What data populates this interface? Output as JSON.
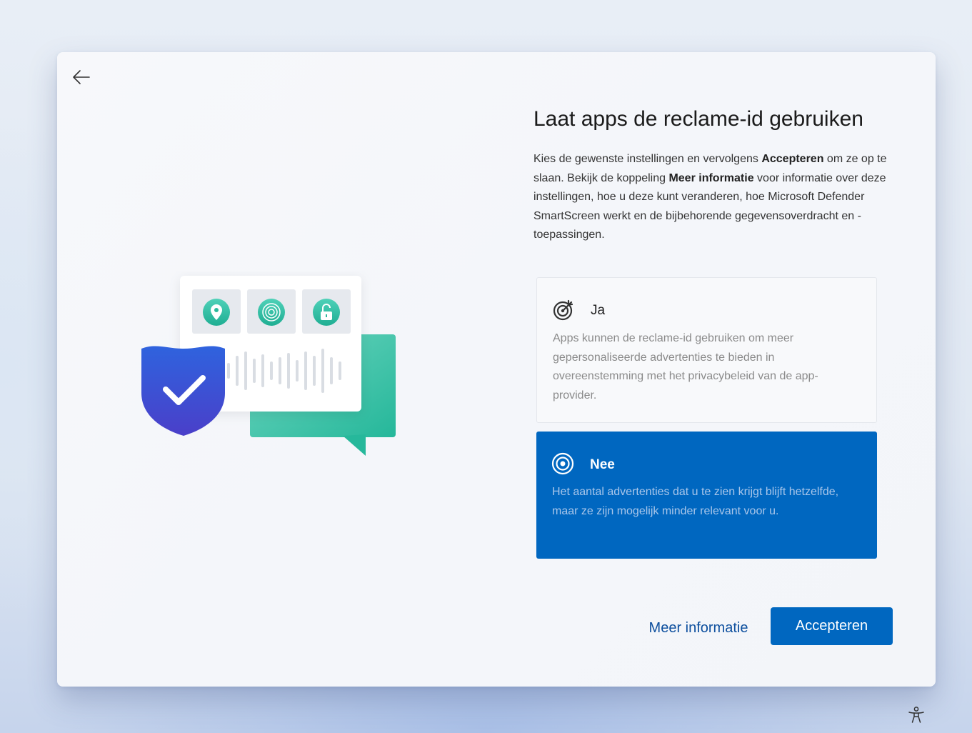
{
  "nav": {
    "back_icon": "arrow-left-icon"
  },
  "page": {
    "title": "Laat apps de reclame-id gebruiken",
    "description": {
      "part1": "Kies de gewenste instellingen en vervolgens ",
      "bold1": "Accepteren",
      "part2": " om ze op te slaan. Bekijk de koppeling ",
      "bold2": "Meer informatie",
      "part3": " voor informatie over deze instellingen, hoe u deze kunt veranderen, hoe Microsoft Defender SmartScreen werkt en de bijbehorende gegevensoverdracht en -toepassingen."
    }
  },
  "options": [
    {
      "id": "ja",
      "label": "Ja",
      "icon": "target-arrow-icon",
      "description": "Apps kunnen de reclame-id gebruiken om meer gepersonaliseerde advertenties te bieden in overeenstemming met het privacybeleid van de app-provider.",
      "selected": false
    },
    {
      "id": "nee",
      "label": "Nee",
      "icon": "target-icon",
      "description": "Het aantal advertenties dat u te zien krijgt blijft hetzelfde, maar ze zijn mogelijk minder relevant voor u.",
      "selected": true
    }
  ],
  "actions": {
    "more_info": "Meer informatie",
    "accept": "Accepteren"
  },
  "footer": {
    "accessibility_icon": "accessibility-icon"
  },
  "colors": {
    "accent": "#0067c0",
    "link": "#0d4f9e",
    "card_bg": "#f8f9fb",
    "illustration_green": "#3fc3a8",
    "shield_blue": "#2d5bd6"
  },
  "illustration": {
    "icons": [
      "location-pin-icon",
      "fingerprint-icon",
      "unlock-icon",
      "shield-check-icon",
      "chat-bubble-icon"
    ]
  }
}
